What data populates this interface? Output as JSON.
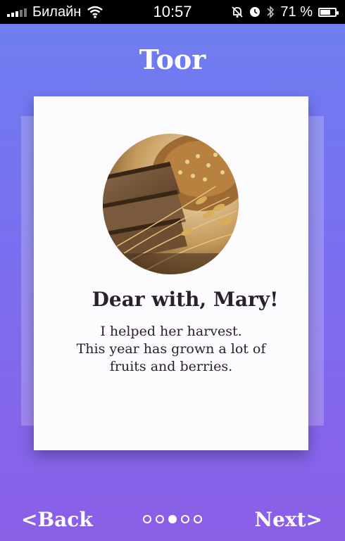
{
  "status_bar": {
    "carrier": "Билайн",
    "time": "10:57",
    "battery_percent": "71 %",
    "battery_level": 0.71,
    "icons": [
      "signal-icon",
      "wifi-icon",
      "mute-icon",
      "alarm-icon",
      "bluetooth-icon",
      "battery-icon"
    ]
  },
  "header": {
    "title": "Toor"
  },
  "card": {
    "image": "bread-and-wheat-photo",
    "heading": "Dear with, Mary!",
    "body_lines": [
      "I helped her harvest.",
      "This year has grown a lot of",
      "fruits and berries."
    ]
  },
  "navigation": {
    "back_label": "<Back",
    "next_label": "Next>",
    "page_count": 5,
    "current_page": 3
  },
  "colors": {
    "gradient_top": "#6d7ff0",
    "gradient_bottom": "#8a5fe6",
    "card_background": "#fcfbfd",
    "text_dark": "#2a1f2a"
  }
}
